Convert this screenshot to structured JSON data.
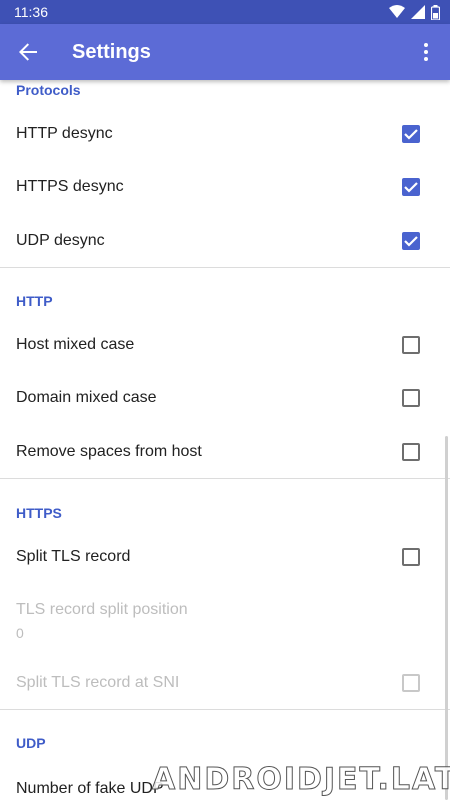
{
  "status_bar": {
    "time": "11:36",
    "icons": [
      "wifi-icon",
      "signal-icon",
      "battery-icon"
    ]
  },
  "app_bar": {
    "title": "Settings",
    "back_icon": "arrow-back-icon",
    "more_icon": "more-vert-icon"
  },
  "sections": {
    "protocols": {
      "header": "Protocols",
      "items": [
        {
          "label": "HTTP desync",
          "checked": true
        },
        {
          "label": "HTTPS desync",
          "checked": true
        },
        {
          "label": "UDP desync",
          "checked": true
        }
      ]
    },
    "http": {
      "header": "HTTP",
      "items": [
        {
          "label": "Host mixed case",
          "checked": false
        },
        {
          "label": "Domain mixed case",
          "checked": false
        },
        {
          "label": "Remove spaces from host",
          "checked": false
        }
      ]
    },
    "https": {
      "header": "HTTPS",
      "split_tls": {
        "label": "Split TLS record",
        "checked": false
      },
      "split_position": {
        "title": "TLS record split position",
        "value": "0"
      },
      "split_at_sni": {
        "label": "Split TLS record at SNI",
        "checked": false,
        "enabled": false
      }
    },
    "udp": {
      "header": "UDP",
      "fake_count": {
        "label": "Number of fake UDP"
      }
    }
  },
  "watermark": "ANDROIDJET.LAT",
  "colors": {
    "status_bar": "#3e51b5",
    "app_bar": "#5c6bd6",
    "accent": "#4a63cf",
    "section_header": "#3f5cc8"
  }
}
